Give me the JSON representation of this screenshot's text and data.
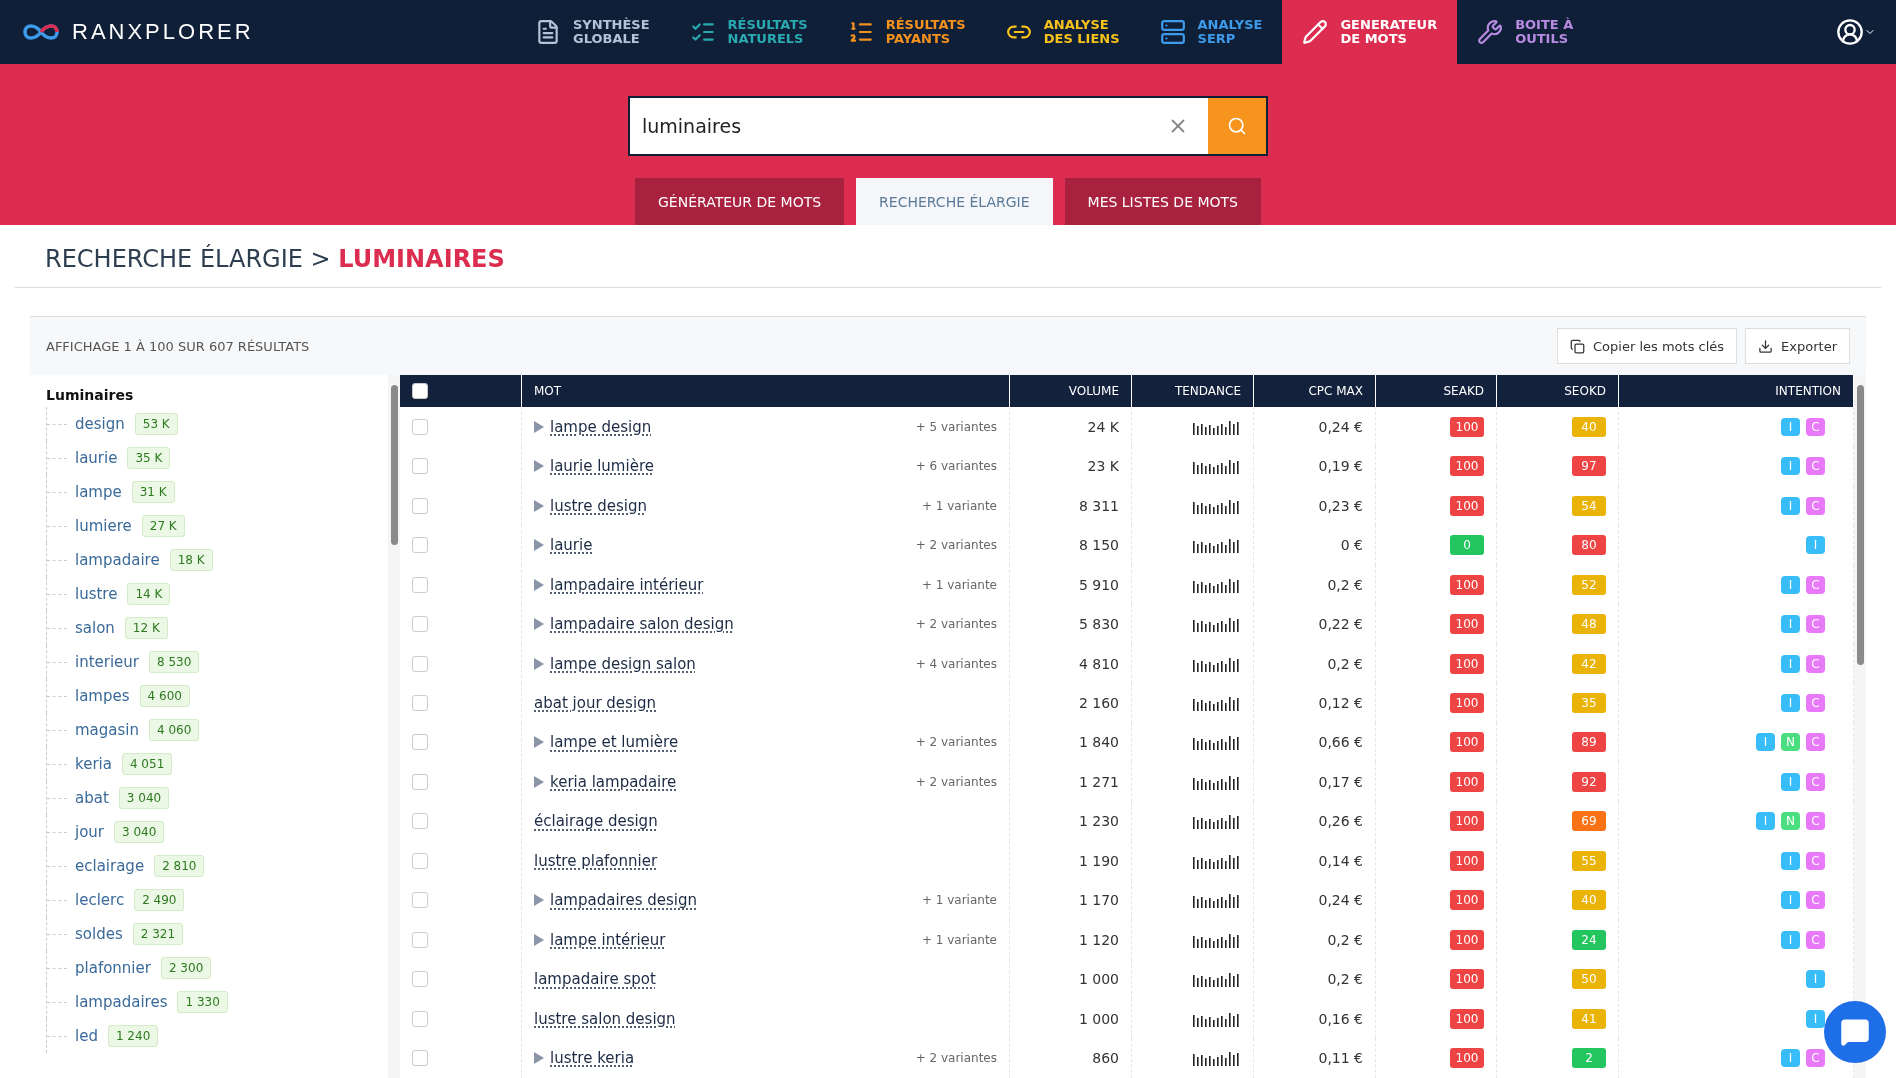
{
  "brand": {
    "name": "RANXPLORER"
  },
  "nav": [
    {
      "line1": "SYNTHÈSE",
      "line2": "GLOBALE",
      "color": "#b4c3d8",
      "selected": false
    },
    {
      "line1": "RÉSULTATS",
      "line2": "NATURELS",
      "color": "#2aa9b0",
      "selected": false
    },
    {
      "line1": "RÉSULTATS",
      "line2": "PAYANTS",
      "color": "#f5921e",
      "selected": false
    },
    {
      "line1": "ANALYSE",
      "line2": "DES LIENS",
      "color": "#f7c21a",
      "selected": false
    },
    {
      "line1": "ANALYSE",
      "line2": "SERP",
      "color": "#3d9be9",
      "selected": false
    },
    {
      "line1": "GENERATEUR",
      "line2": "DE MOTS",
      "color": "#ffffff",
      "selected": true
    },
    {
      "line1": "BOITE À",
      "line2": "OUTILS",
      "color": "#b88be3",
      "selected": false
    }
  ],
  "search": {
    "value": "luminaires"
  },
  "tabs": [
    {
      "label": "GÉNÉRATEUR DE MOTS",
      "selected": false
    },
    {
      "label": "RECHERCHE ÉLARGIE",
      "selected": true
    },
    {
      "label": "MES LISTES DE MOTS",
      "selected": false
    }
  ],
  "heading": {
    "prefix": "RECHERCHE ÉLARGIE >",
    "term": "LUMINAIRES"
  },
  "results_info": "AFFICHAGE 1 À 100 SUR 607 RÉSULTATS",
  "actions": [
    "Copier les mots clés",
    "Exporter"
  ],
  "tree": {
    "root": "Luminaires",
    "children": [
      {
        "label": "design",
        "count": "53 K"
      },
      {
        "label": "laurie",
        "count": "35 K"
      },
      {
        "label": "lampe",
        "count": "31 K"
      },
      {
        "label": "lumiere",
        "count": "27 K"
      },
      {
        "label": "lampadaire",
        "count": "18 K"
      },
      {
        "label": "lustre",
        "count": "14 K"
      },
      {
        "label": "salon",
        "count": "12 K"
      },
      {
        "label": "interieur",
        "count": "8 530"
      },
      {
        "label": "lampes",
        "count": "4 600"
      },
      {
        "label": "magasin",
        "count": "4 060"
      },
      {
        "label": "keria",
        "count": "4 051"
      },
      {
        "label": "abat",
        "count": "3 040"
      },
      {
        "label": "jour",
        "count": "3 040"
      },
      {
        "label": "eclairage",
        "count": "2 810"
      },
      {
        "label": "leclerc",
        "count": "2 490"
      },
      {
        "label": "soldes",
        "count": "2 321"
      },
      {
        "label": "plafonnier",
        "count": "2 300"
      },
      {
        "label": "lampadaires",
        "count": "1 330"
      },
      {
        "label": "led",
        "count": "1 240"
      }
    ]
  },
  "table": {
    "select_all": {
      "checked": false
    },
    "columns": [
      "MOT",
      "VOLUME",
      "TENDANCE",
      "CPC MAX",
      "SEAKD",
      "SEOKD",
      "INTENTION"
    ],
    "rows": [
      {
        "checked": false,
        "word": "lampe design",
        "expandable": true,
        "variants": "+ 5 variantes",
        "volume": "24 K",
        "cpc": "0,24 €",
        "seakd": {
          "value": "100",
          "color": "#ef4444"
        },
        "seokd": {
          "value": "40",
          "color": "#eab308"
        },
        "intents": [
          {
            "label": "I",
            "color": "#38bdf8"
          },
          {
            "label": "C",
            "color": "#e879f9"
          }
        ]
      },
      {
        "checked": false,
        "word": "laurie lumière",
        "expandable": true,
        "variants": "+ 6 variantes",
        "volume": "23 K",
        "cpc": "0,19 €",
        "seakd": {
          "value": "100",
          "color": "#ef4444"
        },
        "seokd": {
          "value": "97",
          "color": "#ef4444"
        },
        "intents": [
          {
            "label": "I",
            "color": "#38bdf8"
          },
          {
            "label": "C",
            "color": "#e879f9"
          }
        ]
      },
      {
        "checked": false,
        "word": "lustre design",
        "expandable": true,
        "variants": "+ 1 variante",
        "volume": "8 311",
        "cpc": "0,23 €",
        "seakd": {
          "value": "100",
          "color": "#ef4444"
        },
        "seokd": {
          "value": "54",
          "color": "#eab308"
        },
        "intents": [
          {
            "label": "I",
            "color": "#38bdf8"
          },
          {
            "label": "C",
            "color": "#e879f9"
          }
        ]
      },
      {
        "checked": false,
        "word": "laurie",
        "expandable": true,
        "variants": "+ 2 variantes",
        "volume": "8 150",
        "cpc": "0 €",
        "seakd": {
          "value": "0",
          "color": "#22c55e"
        },
        "seokd": {
          "value": "80",
          "color": "#ef4444"
        },
        "intents": [
          {
            "label": "I",
            "color": "#38bdf8"
          }
        ]
      },
      {
        "checked": false,
        "word": "lampadaire intérieur",
        "expandable": true,
        "variants": "+ 1 variante",
        "volume": "5 910",
        "cpc": "0,2 €",
        "seakd": {
          "value": "100",
          "color": "#ef4444"
        },
        "seokd": {
          "value": "52",
          "color": "#eab308"
        },
        "intents": [
          {
            "label": "I",
            "color": "#38bdf8"
          },
          {
            "label": "C",
            "color": "#e879f9"
          }
        ]
      },
      {
        "checked": false,
        "word": "lampadaire salon design",
        "expandable": true,
        "variants": "+ 2 variantes",
        "volume": "5 830",
        "cpc": "0,22 €",
        "seakd": {
          "value": "100",
          "color": "#ef4444"
        },
        "seokd": {
          "value": "48",
          "color": "#eab308"
        },
        "intents": [
          {
            "label": "I",
            "color": "#38bdf8"
          },
          {
            "label": "C",
            "color": "#e879f9"
          }
        ]
      },
      {
        "checked": false,
        "word": "lampe design salon",
        "expandable": true,
        "variants": "+ 4 variantes",
        "volume": "4 810",
        "cpc": "0,2 €",
        "seakd": {
          "value": "100",
          "color": "#ef4444"
        },
        "seokd": {
          "value": "42",
          "color": "#eab308"
        },
        "intents": [
          {
            "label": "I",
            "color": "#38bdf8"
          },
          {
            "label": "C",
            "color": "#e879f9"
          }
        ]
      },
      {
        "checked": false,
        "word": "abat jour design",
        "expandable": false,
        "volume": "2 160",
        "cpc": "0,12 €",
        "seakd": {
          "value": "100",
          "color": "#ef4444"
        },
        "seokd": {
          "value": "35",
          "color": "#eab308"
        },
        "intents": [
          {
            "label": "I",
            "color": "#38bdf8"
          },
          {
            "label": "C",
            "color": "#e879f9"
          }
        ]
      },
      {
        "checked": false,
        "word": "lampe et lumière",
        "expandable": true,
        "variants": "+ 2 variantes",
        "volume": "1 840",
        "cpc": "0,66 €",
        "seakd": {
          "value": "100",
          "color": "#ef4444"
        },
        "seokd": {
          "value": "89",
          "color": "#ef4444"
        },
        "intents": [
          {
            "label": "I",
            "color": "#38bdf8"
          },
          {
            "label": "N",
            "color": "#4ade80"
          },
          {
            "label": "C",
            "color": "#e879f9"
          }
        ]
      },
      {
        "checked": false,
        "word": "keria lampadaire",
        "expandable": true,
        "variants": "+ 2 variantes",
        "volume": "1 271",
        "cpc": "0,17 €",
        "seakd": {
          "value": "100",
          "color": "#ef4444"
        },
        "seokd": {
          "value": "92",
          "color": "#ef4444"
        },
        "intents": [
          {
            "label": "I",
            "color": "#38bdf8"
          },
          {
            "label": "C",
            "color": "#e879f9"
          }
        ]
      },
      {
        "checked": false,
        "word": "éclairage design",
        "expandable": false,
        "volume": "1 230",
        "cpc": "0,26 €",
        "seakd": {
          "value": "100",
          "color": "#ef4444"
        },
        "seokd": {
          "value": "69",
          "color": "#f97316"
        },
        "intents": [
          {
            "label": "I",
            "color": "#38bdf8"
          },
          {
            "label": "N",
            "color": "#4ade80"
          },
          {
            "label": "C",
            "color": "#e879f9"
          }
        ]
      },
      {
        "checked": false,
        "word": "lustre plafonnier",
        "expandable": false,
        "volume": "1 190",
        "cpc": "0,14 €",
        "seakd": {
          "value": "100",
          "color": "#ef4444"
        },
        "seokd": {
          "value": "55",
          "color": "#eab308"
        },
        "intents": [
          {
            "label": "I",
            "color": "#38bdf8"
          },
          {
            "label": "C",
            "color": "#e879f9"
          }
        ]
      },
      {
        "checked": false,
        "word": "lampadaires design",
        "expandable": true,
        "variants": "+ 1 variante",
        "volume": "1 170",
        "cpc": "0,24 €",
        "seakd": {
          "value": "100",
          "color": "#ef4444"
        },
        "seokd": {
          "value": "40",
          "color": "#eab308"
        },
        "intents": [
          {
            "label": "I",
            "color": "#38bdf8"
          },
          {
            "label": "C",
            "color": "#e879f9"
          }
        ]
      },
      {
        "checked": false,
        "word": "lampe intérieur",
        "expandable": true,
        "variants": "+ 1 variante",
        "volume": "1 120",
        "cpc": "0,2 €",
        "seakd": {
          "value": "100",
          "color": "#ef4444"
        },
        "seokd": {
          "value": "24",
          "color": "#22c55e"
        },
        "intents": [
          {
            "label": "I",
            "color": "#38bdf8"
          },
          {
            "label": "C",
            "color": "#e879f9"
          }
        ]
      },
      {
        "checked": false,
        "word": "lampadaire spot",
        "expandable": false,
        "volume": "1 000",
        "cpc": "0,2 €",
        "seakd": {
          "value": "100",
          "color": "#ef4444"
        },
        "seokd": {
          "value": "50",
          "color": "#eab308"
        },
        "intents": [
          {
            "label": "I",
            "color": "#38bdf8"
          }
        ]
      },
      {
        "checked": false,
        "word": "lustre salon design",
        "expandable": false,
        "volume": "1 000",
        "cpc": "0,16 €",
        "seakd": {
          "value": "100",
          "color": "#ef4444"
        },
        "seokd": {
          "value": "41",
          "color": "#eab308"
        },
        "intents": [
          {
            "label": "I",
            "color": "#38bdf8"
          }
        ]
      },
      {
        "checked": false,
        "word": "lustre keria",
        "expandable": true,
        "variants": "+ 2 variantes",
        "volume": "860",
        "cpc": "0,11 €",
        "seakd": {
          "value": "100",
          "color": "#ef4444"
        },
        "seokd": {
          "value": "2",
          "color": "#22c55e"
        },
        "intents": [
          {
            "label": "I",
            "color": "#38bdf8"
          },
          {
            "label": "C",
            "color": "#e879f9"
          }
        ]
      }
    ]
  }
}
